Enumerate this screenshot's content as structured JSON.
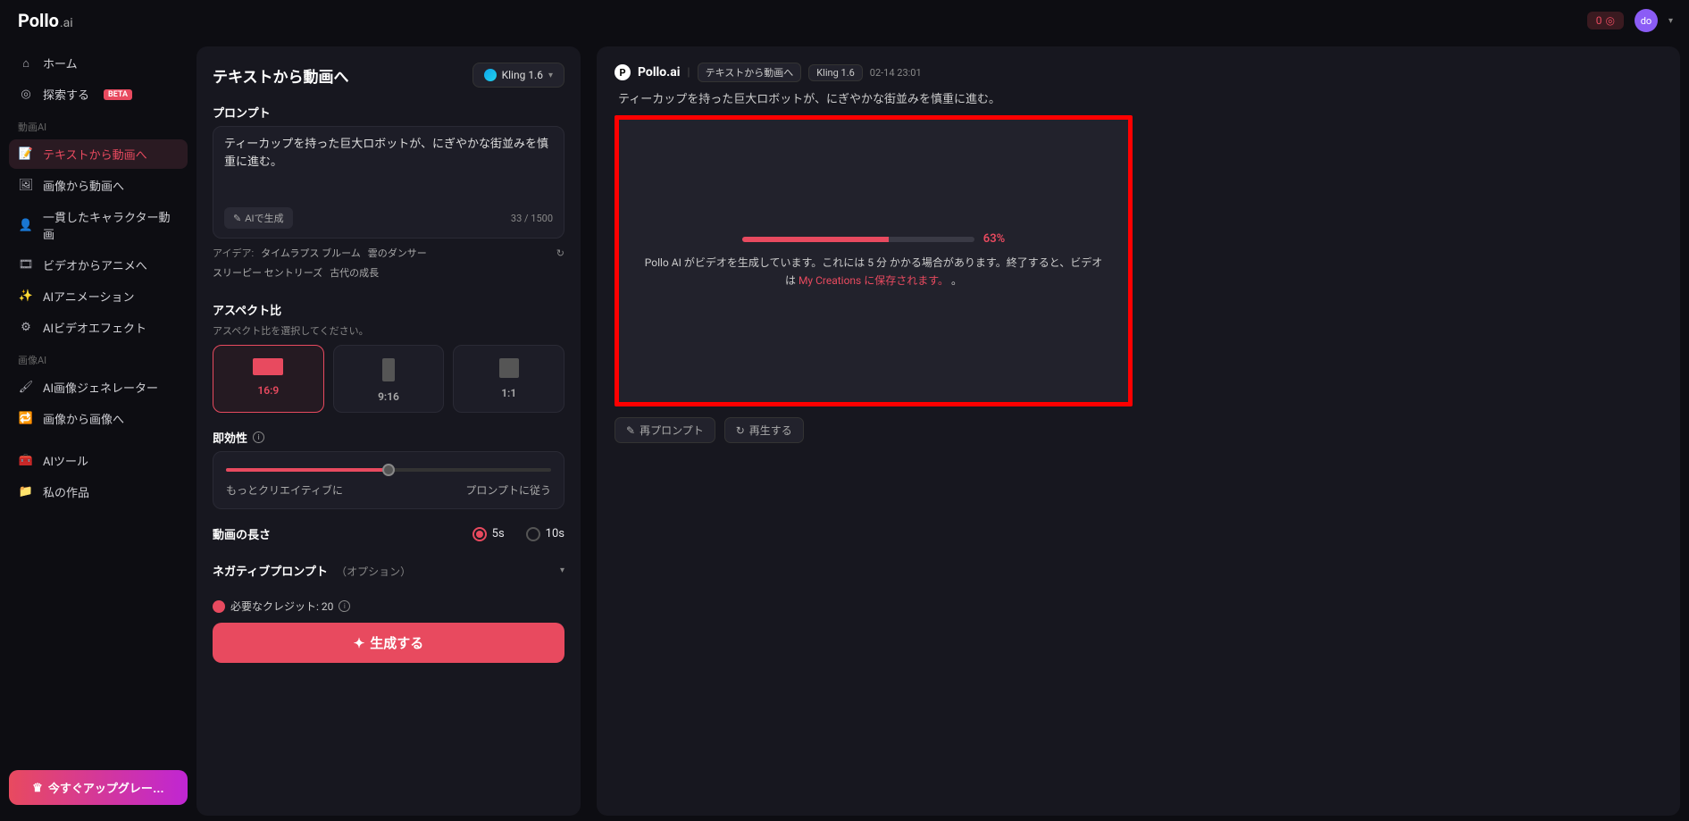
{
  "brand": {
    "name": "Pollo",
    "suffix": ".ai"
  },
  "topbar": {
    "credits": "0",
    "avatar_initials": "do"
  },
  "sidebar": {
    "home": "ホーム",
    "explore": "探索する",
    "beta": "BETA",
    "section_video": "動画AI",
    "video_items": [
      "テキストから動画へ",
      "画像から動画へ",
      "一貫したキャラクター動画",
      "ビデオからアニメへ",
      "AIアニメーション",
      "AIビデオエフェクト"
    ],
    "section_image": "画像AI",
    "image_items": [
      "AI画像ジェネレーター",
      "画像から画像へ"
    ],
    "tools": "AIツール",
    "creations": "私の作品",
    "upgrade": "今すぐアップグレー…"
  },
  "panel": {
    "title": "テキストから動画へ",
    "model": "Kling 1.6",
    "prompt_label": "プロンプト",
    "prompt_value": "ティーカップを持った巨大ロボットが、にぎやかな街並みを慎重に進む。",
    "ai_generate": "AIで生成",
    "char_count": "33 / 1500",
    "ideas_label": "アイデア:",
    "ideas": [
      "タイムラプス ブルーム",
      "雲のダンサー",
      "スリーピー セントリーズ",
      "古代の成長"
    ],
    "aspect_label": "アスペクト比",
    "aspect_help": "アスペクト比を選択してください。",
    "aspects": [
      "16:9",
      "9:16",
      "1:1"
    ],
    "immediacy_label": "即効性",
    "slider_left": "もっとクリエイティブに",
    "slider_right": "プロンプトに従う",
    "length_label": "動画の長さ",
    "length_options": [
      "5s",
      "10s"
    ],
    "negative_label": "ネガティブプロンプト",
    "negative_optional": "（オプション）",
    "credits_label": "必要なクレジット: 20",
    "generate": "生成する"
  },
  "output": {
    "brand": "Pollo.ai",
    "chip1": "テキストから動画へ",
    "chip2": "Kling 1.6",
    "timestamp": "02-14 23:01",
    "prompt": "ティーカップを持った巨大ロボットが、にぎやかな街並みを慎重に進む。",
    "progress_pct": "63%",
    "progress_text_a": "Pollo AI がビデオを生成しています。これには 5 分 かかる場合があります。終了すると、ビデオは ",
    "progress_link": "My Creations に保存されます。",
    "progress_text_b": " 。",
    "reprompt": "再プロンプト",
    "regenerate": "再生する"
  }
}
